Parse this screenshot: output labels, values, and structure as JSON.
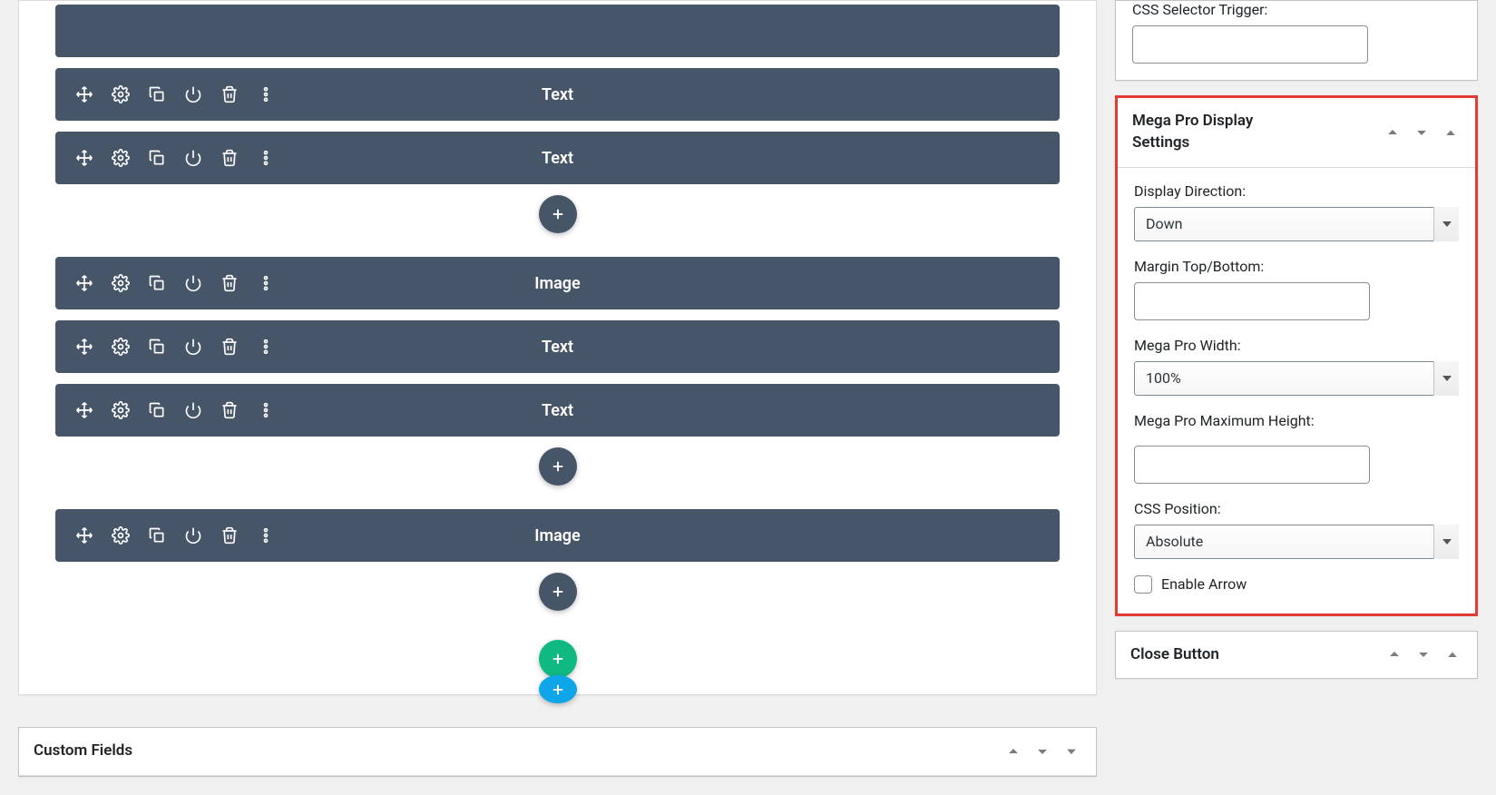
{
  "builder": {
    "blocks": [
      {
        "label": ""
      },
      {
        "label": "Text"
      },
      {
        "label": "Text"
      },
      {
        "label": "Image"
      },
      {
        "label": "Text"
      },
      {
        "label": "Text"
      },
      {
        "label": "Image"
      }
    ]
  },
  "custom_fields_panel": {
    "title": "Custom Fields"
  },
  "side": {
    "css_trigger": {
      "label": "CSS Selector Trigger:",
      "value": ""
    },
    "display_settings": {
      "title": "Mega Pro Display Settings",
      "direction_label": "Display Direction:",
      "direction_value": "Down",
      "margin_label": "Margin Top/Bottom:",
      "margin_value": "",
      "width_label": "Mega Pro Width:",
      "width_value": "100%",
      "max_height_label": "Mega Pro Maximum Height:",
      "max_height_value": "",
      "css_position_label": "CSS Position:",
      "css_position_value": "Absolute",
      "enable_arrow_label": "Enable Arrow"
    },
    "close_button_panel": {
      "title": "Close Button"
    }
  }
}
